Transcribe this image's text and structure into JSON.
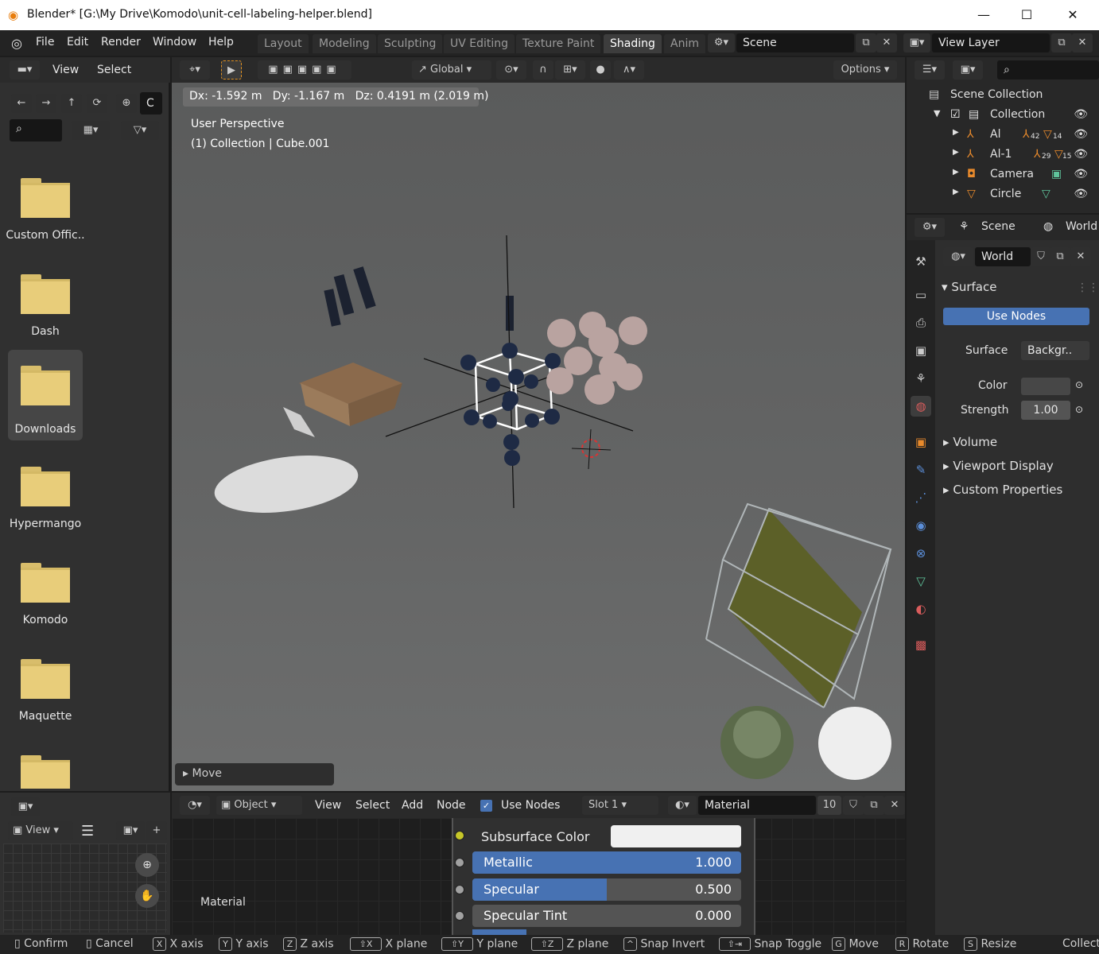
{
  "window": {
    "title": "Blender* [G:\\My Drive\\Komodo\\unit-cell-labeling-helper.blend]",
    "minimize": "—",
    "maximize": "☐",
    "close": "✕"
  },
  "menu": [
    "File",
    "Edit",
    "Render",
    "Window",
    "Help"
  ],
  "workspaces": [
    {
      "label": "Layout"
    },
    {
      "label": "Modeling"
    },
    {
      "label": "Sculpting"
    },
    {
      "label": "UV Editing"
    },
    {
      "label": "Texture Paint"
    },
    {
      "label": "Shading",
      "active": true
    },
    {
      "label": "Anim"
    }
  ],
  "scene_field": "Scene",
  "view_layer_field": "View Layer",
  "filebrowser": {
    "menu": [
      "View",
      "Select"
    ],
    "path_field": "C",
    "folders": [
      "Custom Offic..",
      "Dash",
      "Downloads",
      "Hypermango",
      "Komodo",
      "Maquette",
      ""
    ],
    "selected": "Downloads"
  },
  "viewport": {
    "transform_orientation": "Global",
    "options": "Options",
    "header_info": "Dx: -1.592 m   Dy: -1.167 m   Dz: 0.4191 m (2.019 m)",
    "perspective": "User Perspective",
    "collection_info": "(1) Collection | Cube.001",
    "last_operator": "Move"
  },
  "outliner": {
    "root": "Scene Collection",
    "collection": "Collection",
    "items": [
      {
        "name": "Al",
        "badges": [
          "42",
          "14"
        ]
      },
      {
        "name": "Al-1",
        "badges": [
          "29",
          "15"
        ]
      },
      {
        "name": "Camera",
        "badges": []
      },
      {
        "name": "Circle",
        "badges": []
      }
    ]
  },
  "properties": {
    "breadcrumb_scene": "Scene",
    "breadcrumb_world": "World",
    "world_name": "World",
    "surface_panel": "Surface",
    "use_nodes": "Use Nodes",
    "surface_label": "Surface",
    "surface_value": "Backgr..",
    "color_label": "Color",
    "strength_label": "Strength",
    "strength_value": "1.00",
    "collapsed_panels": [
      "Volume",
      "Viewport Display",
      "Custom Properties"
    ]
  },
  "node_editor": {
    "object_mode": "Object",
    "menu": [
      "View",
      "Select",
      "Add",
      "Node"
    ],
    "use_nodes": "Use Nodes",
    "slot": "Slot 1",
    "material": "Material",
    "users": "10",
    "frame_label": "Material",
    "sockets": [
      {
        "name": "Subsurface Color",
        "type": "color"
      },
      {
        "name": "Metallic",
        "value": "1.000",
        "fill": 1.0
      },
      {
        "name": "Specular",
        "value": "0.500",
        "fill": 0.5
      },
      {
        "name": "Specular Tint",
        "value": "0.000",
        "fill": 0.0
      }
    ]
  },
  "bottom_left": {
    "view": "View"
  },
  "statusbar": [
    {
      "key": "",
      "label": "Confirm"
    },
    {
      "key": "",
      "label": "Cancel"
    },
    {
      "key": "X",
      "label": "X axis"
    },
    {
      "key": "Y",
      "label": "Y axis"
    },
    {
      "key": "Z",
      "label": "Z axis"
    },
    {
      "key": "⇧X",
      "label": "X plane"
    },
    {
      "key": "⇧Y",
      "label": "Y plane"
    },
    {
      "key": "⇧Z",
      "label": "Z plane"
    },
    {
      "key": "^",
      "label": "Snap Invert"
    },
    {
      "key": "⇧⇥",
      "label": "Snap Toggle"
    },
    {
      "key": "G",
      "label": "Move"
    },
    {
      "key": "R",
      "label": "Rotate"
    },
    {
      "key": "S",
      "label": "Resize"
    },
    {
      "key": "",
      "label": "Collecti"
    }
  ],
  "colors": {
    "accent": "#4772b3",
    "folder": "#e8cd7a",
    "active_tab": "#3d3d3d"
  }
}
